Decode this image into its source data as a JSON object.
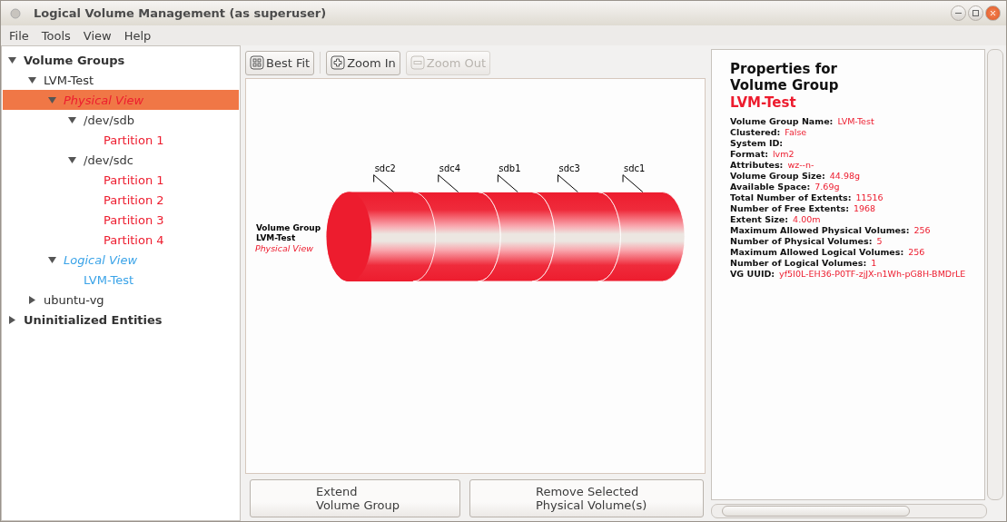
{
  "window": {
    "title": "Logical Volume Management (as superuser)"
  },
  "menu": [
    "File",
    "Tools",
    "View",
    "Help"
  ],
  "tree": [
    {
      "label": "Volume Groups",
      "kind": "section",
      "expanded": true,
      "selected": false,
      "children": [
        {
          "label": "LVM-Test",
          "kind": "group",
          "expanded": true,
          "selected": false,
          "children": [
            {
              "label": "Physical View",
              "kind": "physical-view",
              "expanded": true,
              "selected": true,
              "children": [
                {
                  "label": "/dev/sdb",
                  "kind": "disk",
                  "expanded": true,
                  "selected": false,
                  "children": [
                    {
                      "label": "Partition 1",
                      "kind": "partition",
                      "selected": false
                    }
                  ]
                },
                {
                  "label": "/dev/sdc",
                  "kind": "disk",
                  "expanded": true,
                  "selected": false,
                  "children": [
                    {
                      "label": "Partition 1",
                      "kind": "partition",
                      "selected": false
                    },
                    {
                      "label": "Partition 2",
                      "kind": "partition",
                      "selected": false
                    },
                    {
                      "label": "Partition 3",
                      "kind": "partition",
                      "selected": false
                    },
                    {
                      "label": "Partition 4",
                      "kind": "partition",
                      "selected": false
                    }
                  ]
                }
              ]
            },
            {
              "label": "Logical View",
              "kind": "logical-view",
              "expanded": true,
              "selected": false,
              "children": [
                {
                  "label": "LVM-Test",
                  "kind": "volume",
                  "selected": false
                }
              ]
            }
          ]
        },
        {
          "label": "ubuntu-vg",
          "kind": "group",
          "expanded": false,
          "selected": false
        }
      ]
    },
    {
      "label": "Uninitialized Entities",
      "kind": "section",
      "expanded": false,
      "selected": false
    }
  ],
  "toolbar": [
    {
      "label": "Best Fit",
      "disabled": false
    },
    {
      "label": "Zoom In",
      "disabled": false
    },
    {
      "label": "Zoom Out",
      "disabled": true
    }
  ],
  "diagram": {
    "caption": {
      "title": "Volume Group",
      "name": "LVM-Test",
      "view": "Physical View"
    },
    "segments": [
      "sdc2",
      "sdc4",
      "sdb1",
      "sdc3",
      "sdc1"
    ]
  },
  "actions": [
    "Extend\nVolume Group",
    "Remove Selected\nPhysical Volume(s)"
  ],
  "properties": {
    "heading": "Properties for\nVolume Group",
    "name": "LVM-Test",
    "rows": [
      {
        "label": "Volume Group Name:",
        "value": "LVM-Test"
      },
      {
        "label": "Clustered:",
        "value": "False"
      },
      {
        "label": "System ID:"
      },
      {
        "label": "Format:",
        "value": "lvm2"
      },
      {
        "label": "Attributes:",
        "value": "wz--n-"
      },
      {
        "label": "Volume Group Size:",
        "value": "44.98g"
      },
      {
        "label": "Available Space:",
        "value": "7.69g"
      },
      {
        "label": "Total Number of Extents:",
        "value": "11516"
      },
      {
        "label": "Number of Free Extents:",
        "value": "1968"
      },
      {
        "label": "Extent Size:",
        "value": "4.00m"
      },
      {
        "label": "Maximum Allowed Physical Volumes:",
        "value": "256"
      },
      {
        "label": "Number of Physical Volumes:",
        "value": "5"
      },
      {
        "label": "Maximum Allowed Logical Volumes:",
        "value": "256"
      },
      {
        "label": "Number of Logical Volumes:",
        "value": "1"
      },
      {
        "label": "VG UUID:",
        "value": "yf5I0L-EH36-P0TF-zjJX-n1Wh-pG8H-BMDrLE"
      }
    ]
  }
}
